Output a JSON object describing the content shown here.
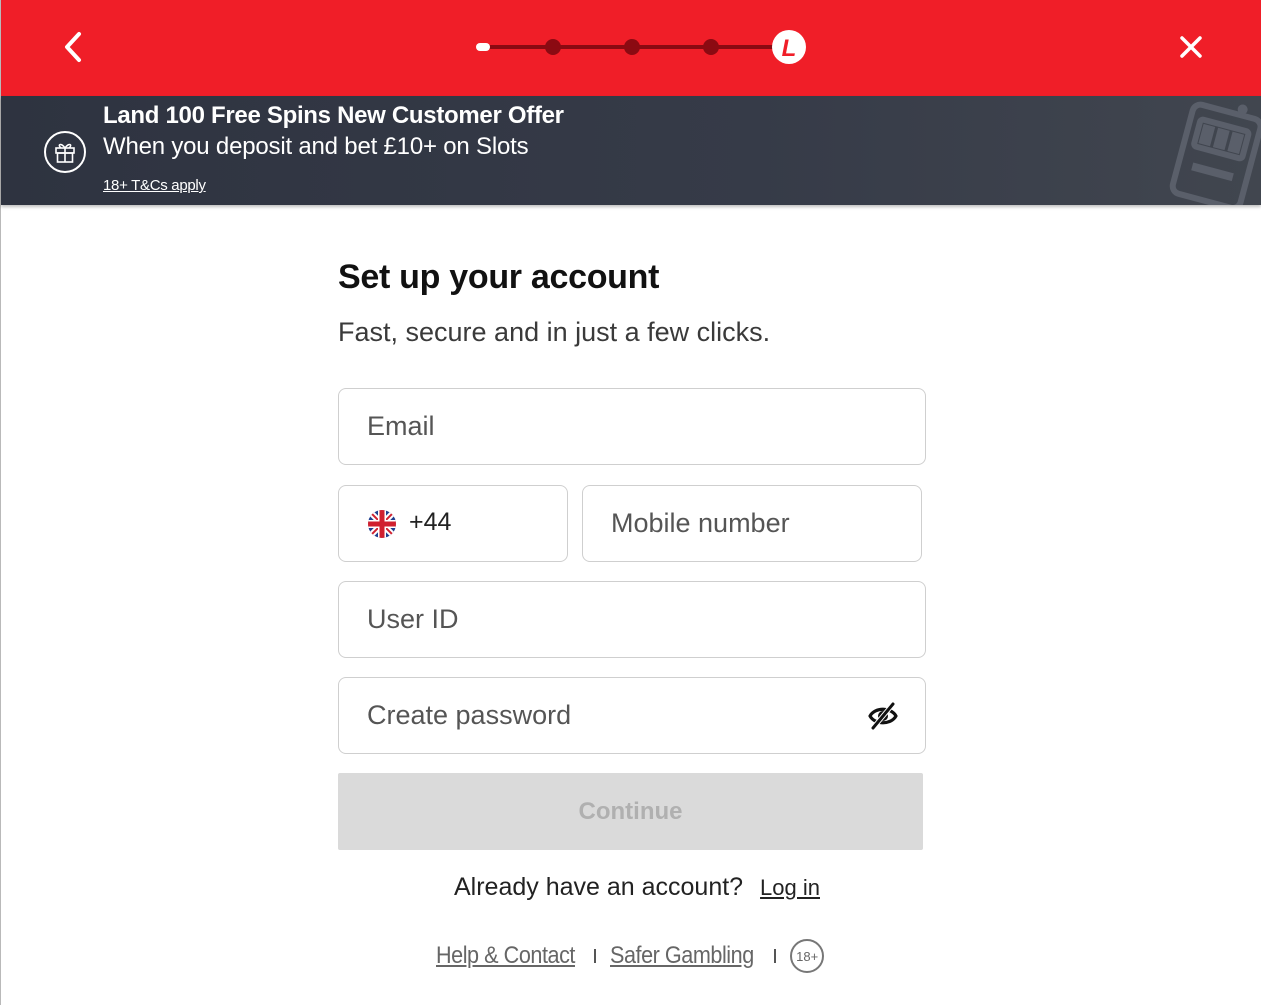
{
  "header": {
    "back_icon": "chevron-left-icon",
    "close_icon": "close-icon",
    "progress": {
      "total_steps": 5,
      "current_step": 5,
      "logo_letter": "L",
      "color": "#f01e28"
    }
  },
  "promo": {
    "icon": "gift-icon",
    "title": "Land 100 Free Spins New Customer Offer",
    "subtitle": "When you deposit and bet £10+ on Slots",
    "terms_link": "18+ T&Cs apply",
    "decoration_icon": "slot-machine-icon"
  },
  "form": {
    "heading": "Set up your account",
    "subheading": "Fast, secure and in just a few clicks.",
    "email_placeholder": "Email",
    "country_code": "+44",
    "country_flag_icon": "uk-flag-icon",
    "mobile_placeholder": "Mobile number",
    "userid_placeholder": "User ID",
    "password_placeholder": "Create password",
    "password_toggle_icon": "eye-off-icon",
    "continue_label": "Continue",
    "login_prompt": "Already have an account?",
    "login_link": "Log in"
  },
  "footer": {
    "help_link": "Help & Contact",
    "safer_link": "Safer Gambling",
    "age_badge": "18+"
  },
  "colors": {
    "brand_red": "#f01e28",
    "banner_dark": "#363b48",
    "button_disabled": "#dadada"
  }
}
